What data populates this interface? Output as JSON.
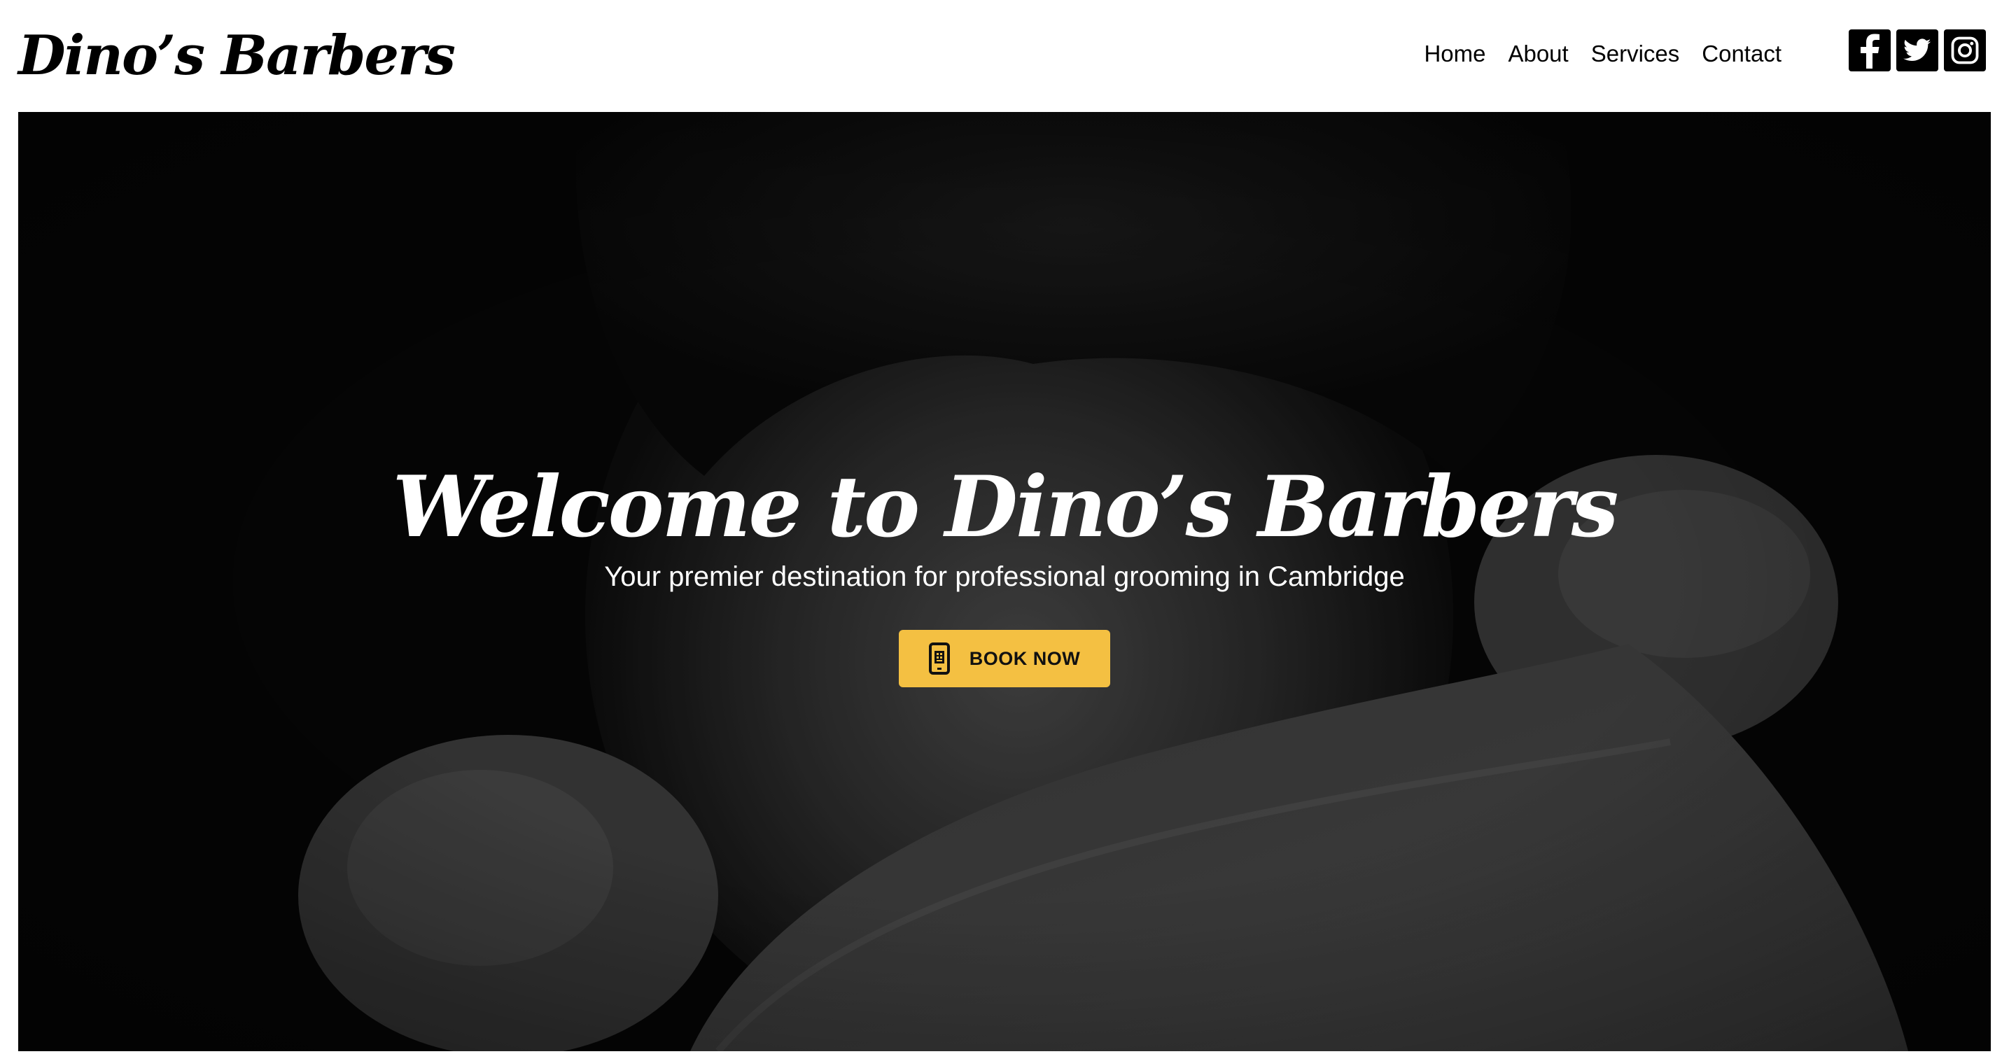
{
  "header": {
    "logo_text": "Dino’s Barbers",
    "nav": [
      {
        "label": "Home"
      },
      {
        "label": "About"
      },
      {
        "label": "Services"
      },
      {
        "label": "Contact"
      }
    ],
    "social": [
      {
        "icon": "facebook-icon"
      },
      {
        "icon": "twitter-icon"
      },
      {
        "icon": "instagram-icon"
      }
    ]
  },
  "hero": {
    "title": "Welcome to Dino’s Barbers",
    "subtitle": "Your premier destination for professional grooming in Cambridge",
    "cta_label": "BOOK NOW",
    "cta_icon": "phone-icon",
    "cta_color": "#f4c042"
  }
}
